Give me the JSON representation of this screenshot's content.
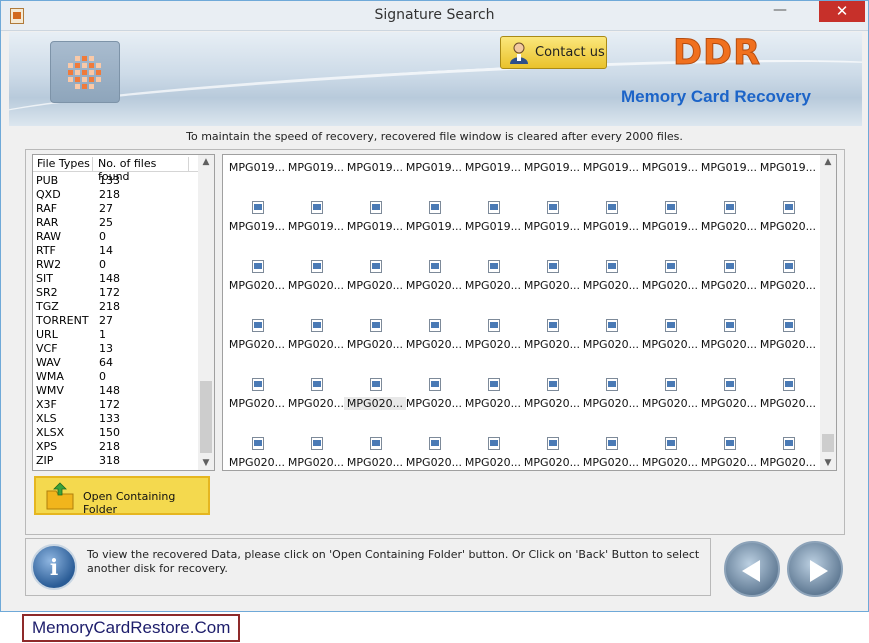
{
  "window": {
    "title": "Signature Search",
    "minimize": "—",
    "close": "✕"
  },
  "header": {
    "contact_label": "Contact us",
    "brand_name": "DDR",
    "brand_subtitle": "Memory Card Recovery"
  },
  "notice": "To maintain the speed of recovery, recovered file window is cleared after every 2000 files.",
  "file_types": {
    "col_type": "File Types",
    "col_count": "No. of files found",
    "rows": [
      {
        "type": "PUB",
        "count": "133"
      },
      {
        "type": "QXD",
        "count": "218"
      },
      {
        "type": "RAF",
        "count": "27"
      },
      {
        "type": "RAR",
        "count": "25"
      },
      {
        "type": "RAW",
        "count": "0"
      },
      {
        "type": "RTF",
        "count": "14"
      },
      {
        "type": "RW2",
        "count": "0"
      },
      {
        "type": "SIT",
        "count": "148"
      },
      {
        "type": "SR2",
        "count": "172"
      },
      {
        "type": "TGZ",
        "count": "218"
      },
      {
        "type": "TORRENT",
        "count": "27"
      },
      {
        "type": "URL",
        "count": "1"
      },
      {
        "type": "VCF",
        "count": "13"
      },
      {
        "type": "WAV",
        "count": "64"
      },
      {
        "type": "WMA",
        "count": "0"
      },
      {
        "type": "WMV",
        "count": "148"
      },
      {
        "type": "X3F",
        "count": "172"
      },
      {
        "type": "XLS",
        "count": "133"
      },
      {
        "type": "XLSX",
        "count": "150"
      },
      {
        "type": "XPS",
        "count": "218"
      },
      {
        "type": "ZIP",
        "count": "318"
      }
    ]
  },
  "open_folder_label": "Open Containing Folder",
  "files": {
    "rows": [
      [
        "MPG019...",
        "MPG019...",
        "MPG019...",
        "MPG019...",
        "MPG019...",
        "MPG019...",
        "MPG019...",
        "MPG019...",
        "MPG019...",
        "MPG019..."
      ],
      [
        "MPG019...",
        "MPG019...",
        "MPG019...",
        "MPG019...",
        "MPG019...",
        "MPG019...",
        "MPG019...",
        "MPG019...",
        "MPG020...",
        "MPG020..."
      ],
      [
        "MPG020...",
        "MPG020...",
        "MPG020...",
        "MPG020...",
        "MPG020...",
        "MPG020...",
        "MPG020...",
        "MPG020...",
        "MPG020...",
        "MPG020..."
      ],
      [
        "MPG020...",
        "MPG020...",
        "MPG020...",
        "MPG020...",
        "MPG020...",
        "MPG020...",
        "MPG020...",
        "MPG020...",
        "MPG020...",
        "MPG020..."
      ],
      [
        "MPG020...",
        "MPG020...",
        "MPG020...",
        "MPG020...",
        "MPG020...",
        "MPG020...",
        "MPG020...",
        "MPG020...",
        "MPG020...",
        "MPG020..."
      ],
      [
        "MPG020...",
        "MPG020...",
        "MPG020...",
        "MPG020...",
        "MPG020...",
        "MPG020...",
        "MPG020...",
        "MPG020...",
        "MPG020...",
        "MPG020..."
      ]
    ],
    "selected": {
      "row": 4,
      "col": 2
    }
  },
  "status_text": "To view the recovered Data, please click on 'Open Containing Folder' button. Or Click on 'Back' Button to select another disk for recovery.",
  "footer_link": "MemoryCardRestore.Com",
  "colors": {
    "accent_orange": "#f0701e",
    "brand_blue": "#1c64c8",
    "button_yellow": "#f4d94e"
  }
}
